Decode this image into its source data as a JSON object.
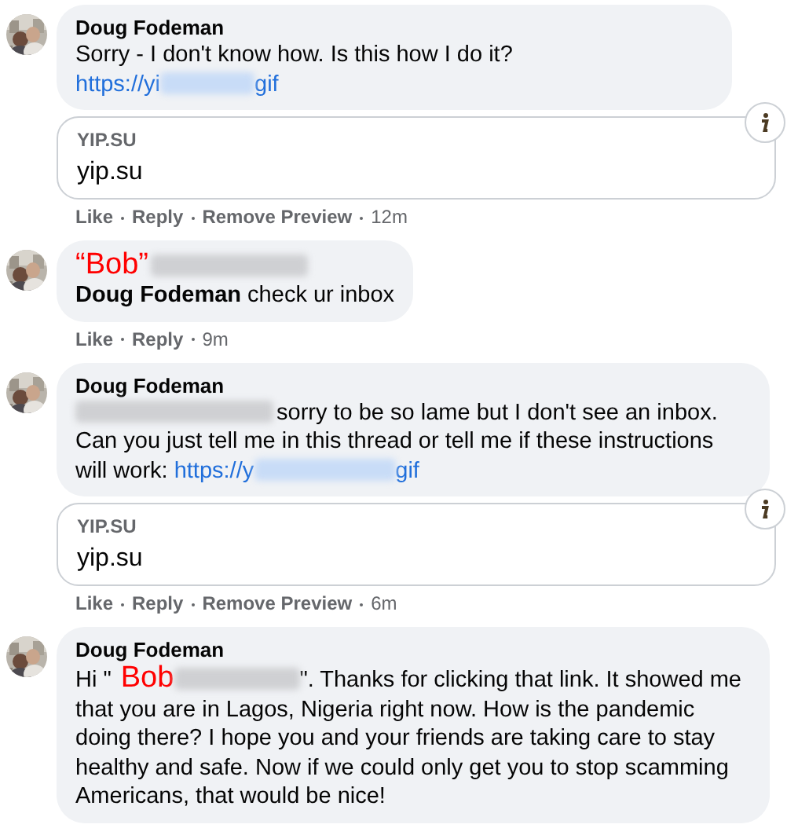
{
  "comments": [
    {
      "author": {
        "kind": "name",
        "text": "Doug Fodeman"
      },
      "body": [
        {
          "kind": "text",
          "text": "Sorry - I don't know how. Is this how I do it?"
        },
        {
          "kind": "break"
        },
        {
          "kind": "link",
          "start": "https://yi",
          "end": "gif"
        }
      ],
      "preview": {
        "domain": "YIP.SU",
        "title": "yip.su"
      },
      "actions": [
        "Like",
        "Reply",
        "Remove Preview"
      ],
      "time": "12m"
    },
    {
      "author": {
        "kind": "tag",
        "text": "“Bob”"
      },
      "body": [
        {
          "kind": "rich",
          "text": "**Doug Fodeman** check ur inbox"
        }
      ],
      "actions": [
        "Like",
        "Reply"
      ],
      "time": "9m"
    },
    {
      "author": {
        "kind": "name",
        "text": "Doug Fodeman"
      },
      "body": [
        {
          "kind": "redacted"
        },
        {
          "kind": "text",
          "text": "sorry to be so lame but I don't see an inbox. Can you just tell me in this thread or tell me if these instructions will work: "
        },
        {
          "kind": "link",
          "start": "https://y",
          "end": "gif"
        }
      ],
      "preview": {
        "domain": "YIP.SU",
        "title": "yip.su"
      },
      "actions": [
        "Like",
        "Reply",
        "Remove Preview"
      ],
      "time": "6m"
    },
    {
      "author": {
        "kind": "name",
        "text": "Doug Fodeman"
      },
      "body": [
        {
          "kind": "text",
          "text": "Hi \""
        },
        {
          "kind": "tag",
          "text": "Bob"
        },
        {
          "kind": "redacted"
        },
        {
          "kind": "text",
          "text": "\". Thanks for clicking that link. It showed me that you are in Lagos, Nigeria right now. How is the pandemic doing there? I hope you and your friends are taking care to stay healthy and safe. Now if we could only get you to stop scamming Americans, that would be nice!"
        }
      ]
    }
  ]
}
